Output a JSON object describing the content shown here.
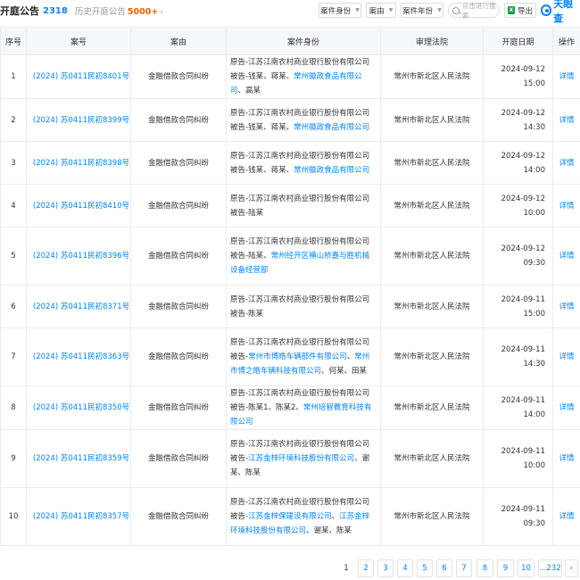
{
  "header": {
    "title": "开庭公告",
    "count": "2318",
    "history_label": "历史开庭公告",
    "history_count": "5000+",
    "history_arrow": "›"
  },
  "filters": [
    {
      "label": "案件身份"
    },
    {
      "label": "案由"
    },
    {
      "label": "案件年份"
    }
  ],
  "search": {
    "placeholder": "点击进行搜索"
  },
  "export": {
    "icon": "X",
    "label": "导出"
  },
  "brand": {
    "name": "天眼查"
  },
  "table": {
    "columns": [
      "序号",
      "案号",
      "案由",
      "案件身份",
      "审理法院",
      "开庭日期",
      "操作"
    ],
    "rows": [
      {
        "seq": "1",
        "case_no": "(2024) 苏0411民初8401号",
        "cause": "金融借款合同纠纷",
        "plaintiff": "原告-江苏江南农村商业银行股份有限公司",
        "defendant": [
          {
            "t": "被告-钱某、蒋某、",
            "link": false
          },
          {
            "t": "常州徽政食品有限公司",
            "link": true
          },
          {
            "t": "、高某",
            "link": false
          }
        ],
        "court": "常州市新北区人民法院",
        "date": "2024-09-12 15:00",
        "op": "详情"
      },
      {
        "seq": "2",
        "case_no": "(2024) 苏0411民初8399号",
        "cause": "金融借款合同纠纷",
        "plaintiff": "原告-江苏江南农村商业银行股份有限公司",
        "defendant": [
          {
            "t": "被告-钱某、蒋某、",
            "link": false
          },
          {
            "t": "常州徽政食品有限公司",
            "link": true
          }
        ],
        "court": "常州市新北区人民法院",
        "date": "2024-09-12 14:30",
        "op": "详情"
      },
      {
        "seq": "3",
        "case_no": "(2024) 苏0411民初8398号",
        "cause": "金融借款合同纠纷",
        "plaintiff": "原告-江苏江南农村商业银行股份有限公司",
        "defendant": [
          {
            "t": "被告-钱某、蒋某、",
            "link": false
          },
          {
            "t": "常州徽政食品有限公司",
            "link": true
          }
        ],
        "court": "常州市新北区人民法院",
        "date": "2024-09-12 14:00",
        "op": "详情"
      },
      {
        "seq": "4",
        "case_no": "(2024) 苏0411民初8410号",
        "cause": "金融借款合同纠纷",
        "plaintiff": "原告-江苏江南农村商业银行股份有限公司",
        "defendant": [
          {
            "t": "被告-陆某",
            "link": false
          }
        ],
        "court": "常州市新北区人民法院",
        "date": "2024-09-12 10:00",
        "op": "详情"
      },
      {
        "seq": "5",
        "case_no": "(2024) 苏0411民初8396号",
        "cause": "金融借款合同纠纷",
        "plaintiff": "原告-江苏江南农村商业银行股份有限公司",
        "defendant": [
          {
            "t": "被告-陆某、",
            "link": false
          },
          {
            "t": "常州经开区横山桥嘉与胜机械设备经营部",
            "link": true
          }
        ],
        "court": "常州市新北区人民法院",
        "date": "2024-09-12 09:30",
        "op": "详情"
      },
      {
        "seq": "6",
        "case_no": "(2024) 苏0411民初8371号",
        "cause": "金融借款合同纠纷",
        "plaintiff": "原告-江苏江南农村商业银行股份有限公司",
        "defendant": [
          {
            "t": "被告-陈某",
            "link": false
          }
        ],
        "court": "常州市新北区人民法院",
        "date": "2024-09-11 15:00",
        "op": "详情"
      },
      {
        "seq": "7",
        "case_no": "(2024) 苏0411民初8363号",
        "cause": "金融借款合同纠纷",
        "plaintiff": "原告-江苏江南农村商业银行股份有限公司",
        "defendant": [
          {
            "t": "被告-",
            "link": false
          },
          {
            "t": "常州市博皓车辆部件有限公司",
            "link": true
          },
          {
            "t": "、",
            "link": false
          },
          {
            "t": "常州市博之皓车辆科技有限公司",
            "link": true
          },
          {
            "t": "、何某、田某",
            "link": false
          }
        ],
        "court": "常州市新北区人民法院",
        "date": "2024-09-11 14:30",
        "op": "详情"
      },
      {
        "seq": "8",
        "case_no": "(2024) 苏0411民初8350号",
        "cause": "金融借款合同纠纷",
        "plaintiff": "原告-江苏江南农村商业银行股份有限公司",
        "defendant": [
          {
            "t": "被告-陈某1、陈某2、",
            "link": false
          },
          {
            "t": "常州培智教育科技有限公司",
            "link": true
          }
        ],
        "court": "常州市新北区人民法院",
        "date": "2024-09-11 14:00",
        "op": "详情"
      },
      {
        "seq": "9",
        "case_no": "(2024) 苏0411民初8359号",
        "cause": "金融借款合同纠纷",
        "plaintiff": "原告-江苏江南农村商业银行股份有限公司",
        "defendant": [
          {
            "t": "被告-",
            "link": false
          },
          {
            "t": "江苏金梓环境科技股份有限公司",
            "link": true
          },
          {
            "t": "、谢某、陈某",
            "link": false
          }
        ],
        "court": "常州市新北区人民法院",
        "date": "2024-09-11 10:00",
        "op": "详情"
      },
      {
        "seq": "10",
        "case_no": "(2024) 苏0411民初8357号",
        "cause": "金融借款合同纠纷",
        "plaintiff": "原告-江苏江南农村商业银行股份有限公司",
        "defendant": [
          {
            "t": "被告-",
            "link": false
          },
          {
            "t": "江苏金梓保建设有限公司",
            "link": true
          },
          {
            "t": "、",
            "link": false
          },
          {
            "t": "江苏金梓环境科技股份有限公司",
            "link": true
          },
          {
            "t": "、谢某、陈某",
            "link": false
          }
        ],
        "court": "常州市新北区人民法院",
        "date": "2024-09-11 09:30",
        "op": "详情"
      }
    ]
  },
  "pagination": {
    "pages": [
      "1",
      "2",
      "3",
      "4",
      "5",
      "6",
      "7",
      "8",
      "9",
      "10",
      "...232",
      "›"
    ],
    "current": "1"
  }
}
